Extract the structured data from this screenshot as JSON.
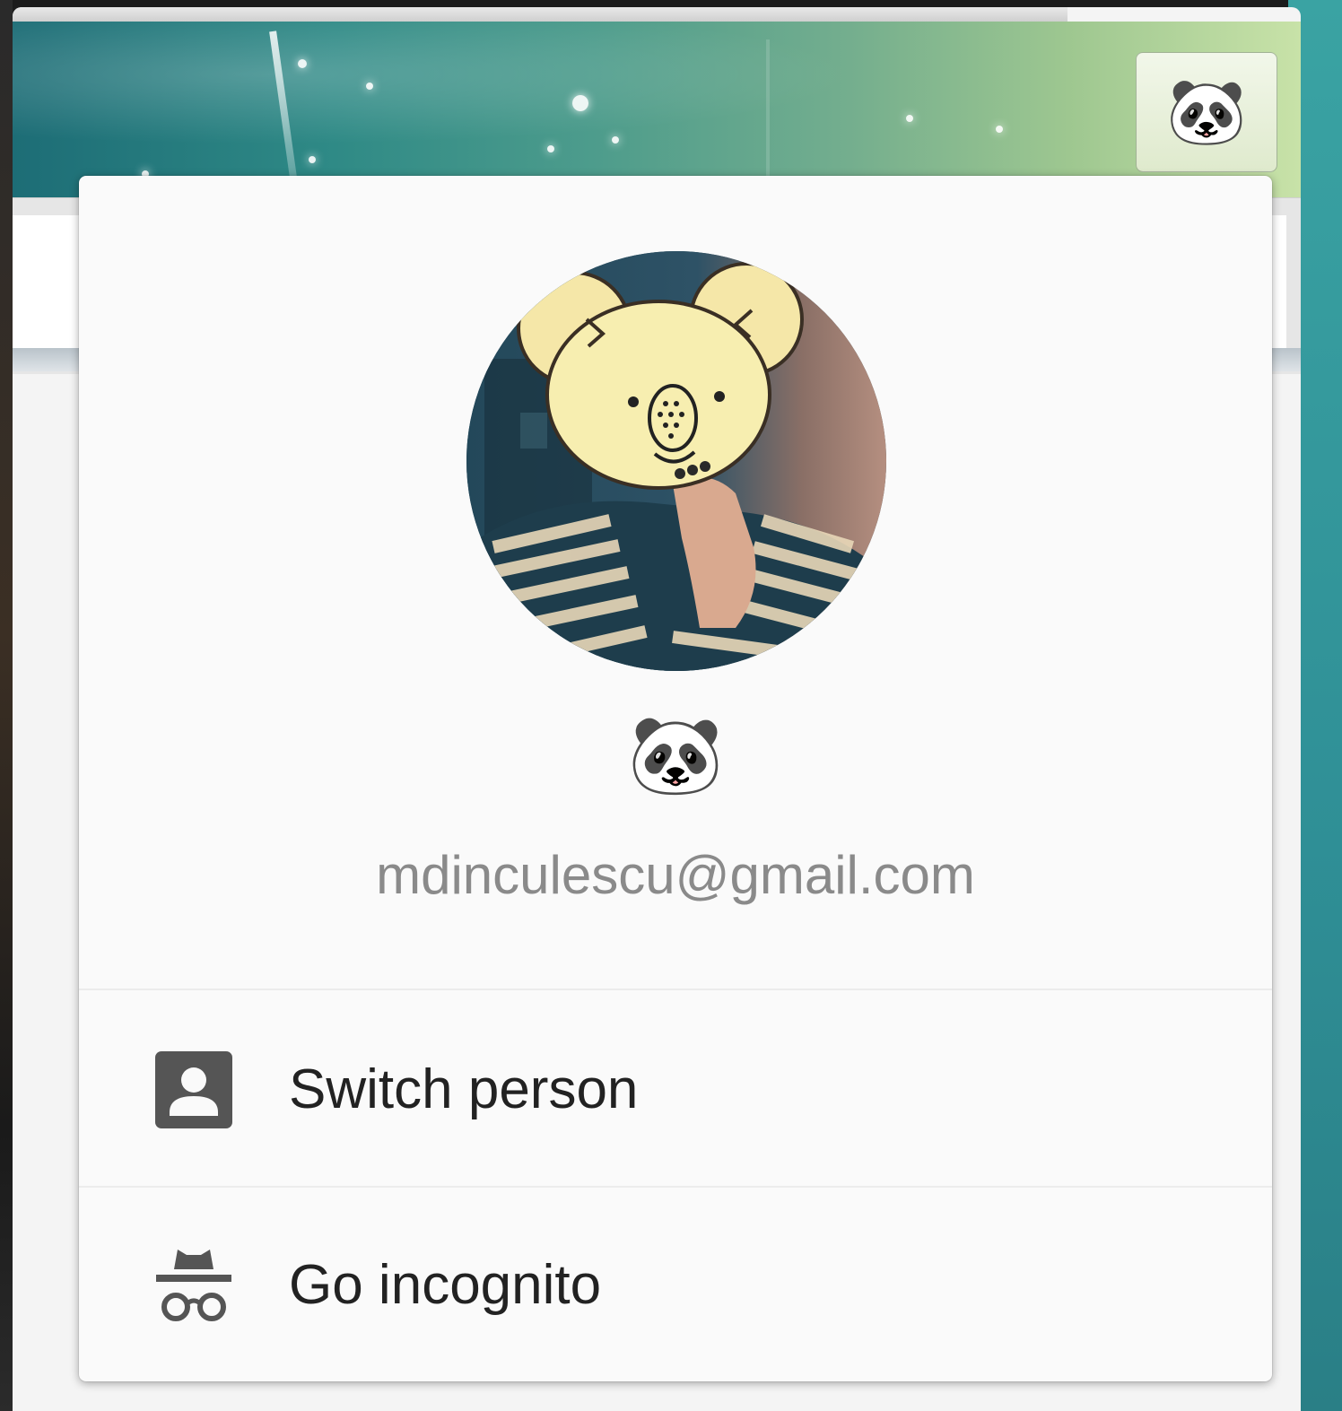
{
  "toolbar": {
    "avatar_emoji": "🐼"
  },
  "menu": {
    "profile": {
      "emoji": "🐼",
      "email": "mdinculescu@gmail.com"
    },
    "items": [
      {
        "label": "Switch person",
        "icon": "person-icon"
      },
      {
        "label": "Go incognito",
        "icon": "incognito-icon"
      }
    ]
  },
  "colors": {
    "popup_background": "#fafafa",
    "email_text": "#8a8a8a",
    "item_text": "#222222",
    "icon_gray": "#555555",
    "theme_teal": "#2f8a86"
  }
}
